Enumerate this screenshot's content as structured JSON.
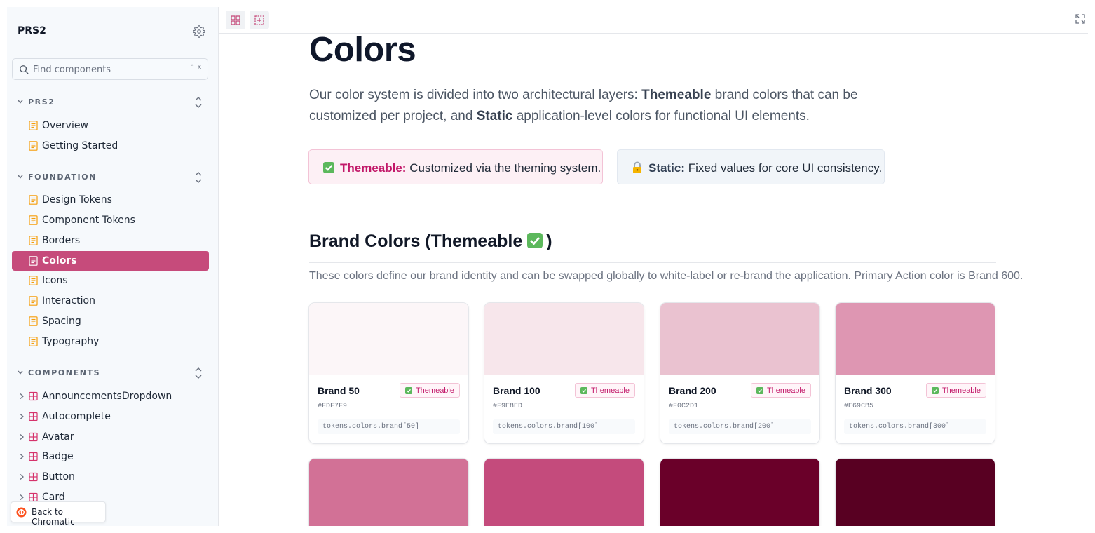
{
  "sidebar": {
    "brand": "PRS2",
    "search": {
      "placeholder": "Find components",
      "shortcut": "⌃ K"
    },
    "sections": [
      {
        "title": "PRS2",
        "items": [
          "Overview",
          "Getting Started"
        ]
      },
      {
        "title": "FOUNDATION",
        "items": [
          "Design Tokens",
          "Component Tokens",
          "Borders",
          "Colors",
          "Icons",
          "Interaction",
          "Spacing",
          "Typography"
        ],
        "active": "Colors"
      },
      {
        "title": "COMPONENTS",
        "items": [
          "AnnouncementsDropdown",
          "Autocomplete",
          "Avatar",
          "Badge",
          "Button",
          "Card"
        ]
      }
    ],
    "back_link": "Back to Chromatic"
  },
  "main": {
    "title": "Colors",
    "intro": {
      "part1": "Our color system is divided into two architectural layers: ",
      "bold1": "Themeable",
      "part2": " brand colors that can be customized per project, and ",
      "bold2": "Static",
      "part3": " application-level colors for functional UI elements."
    },
    "callouts": [
      {
        "key": "Themeable:",
        "text": " Customized via the theming system.",
        "icon": "check-emoji-icon"
      },
      {
        "key": "Static:",
        "text": " Fixed values for core UI consistency.",
        "icon": "lock-emoji-icon"
      }
    ],
    "brand_section": {
      "heading_prefix": "Brand Colors (Themeable",
      "heading_suffix": ")",
      "description": "These colors define our brand identity and can be swapped globally to white-label or re-brand the application. Primary Action color is Brand 600."
    },
    "badge_label": "Themeable",
    "cards": [
      {
        "name": "Brand 50",
        "hex": "#FDF7F9",
        "token": "tokens.colors.brand[50]"
      },
      {
        "name": "Brand 100",
        "hex": "#F9E8ED",
        "token": "tokens.colors.brand[100]"
      },
      {
        "name": "Brand 200",
        "hex": "#F0C2D1",
        "token": "tokens.colors.brand[200]"
      },
      {
        "name": "Brand 300",
        "hex": "#E69CB5",
        "token": "tokens.colors.brand[300]"
      }
    ],
    "second_row_colors": [
      "#d27196",
      "#c44b7c",
      "#6a0029",
      "#580022"
    ]
  },
  "colors": {
    "accent": "#c64b7b",
    "themeable_text": "#c21869",
    "card_swatches": [
      "#fcf6f8",
      "#f7e6eb",
      "#eac2d0",
      "#de96b2"
    ]
  }
}
